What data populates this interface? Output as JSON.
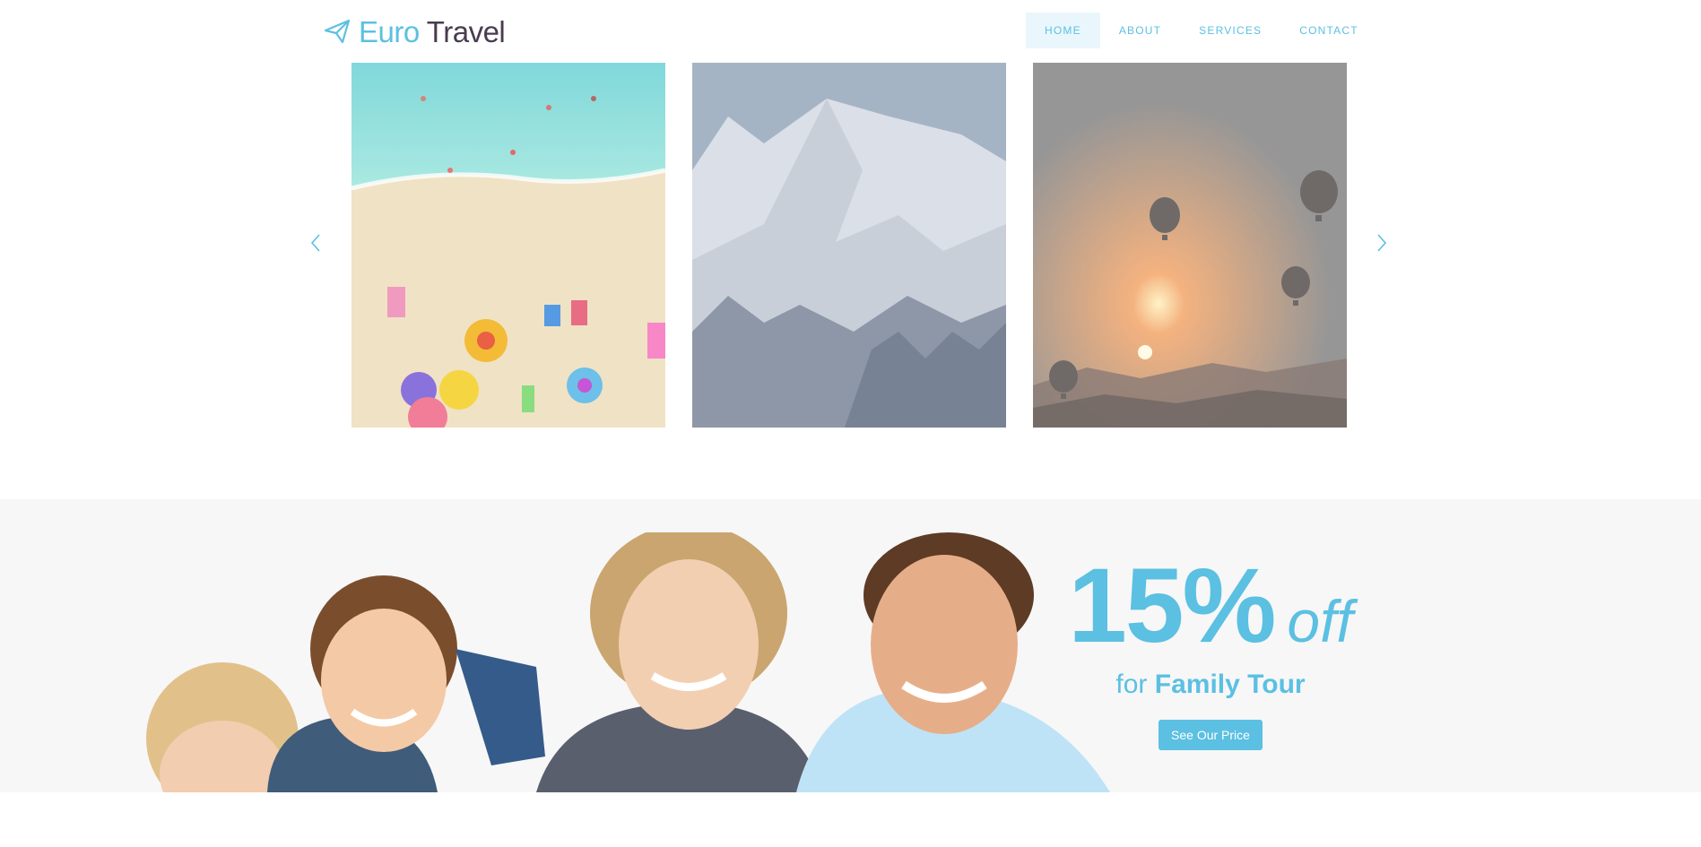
{
  "brand": {
    "word1": "Euro",
    "word2": "Travel",
    "icon": "paper-plane-icon"
  },
  "nav": {
    "items": [
      {
        "label": "HOME",
        "active": true
      },
      {
        "label": "ABOUT",
        "active": false
      },
      {
        "label": "SERVICES",
        "active": false
      },
      {
        "label": "CONTACT",
        "active": false
      }
    ]
  },
  "carousel": {
    "prev_icon": "chevron-left-icon",
    "next_icon": "chevron-right-icon",
    "slides": [
      "beach-photo",
      "snowy-mountain-photo",
      "hot-air-balloons-sunset-photo"
    ]
  },
  "promo": {
    "percent": "15%",
    "off": "off",
    "for_prefix": "for",
    "for_bold": "Family Tour",
    "cta_label": "See Our Price"
  },
  "colors": {
    "accent": "#5bc0e2",
    "brand_dark": "#4a3b4f",
    "nav_active_bg": "#e9f7fc",
    "promo_bg": "#f7f7f7"
  }
}
